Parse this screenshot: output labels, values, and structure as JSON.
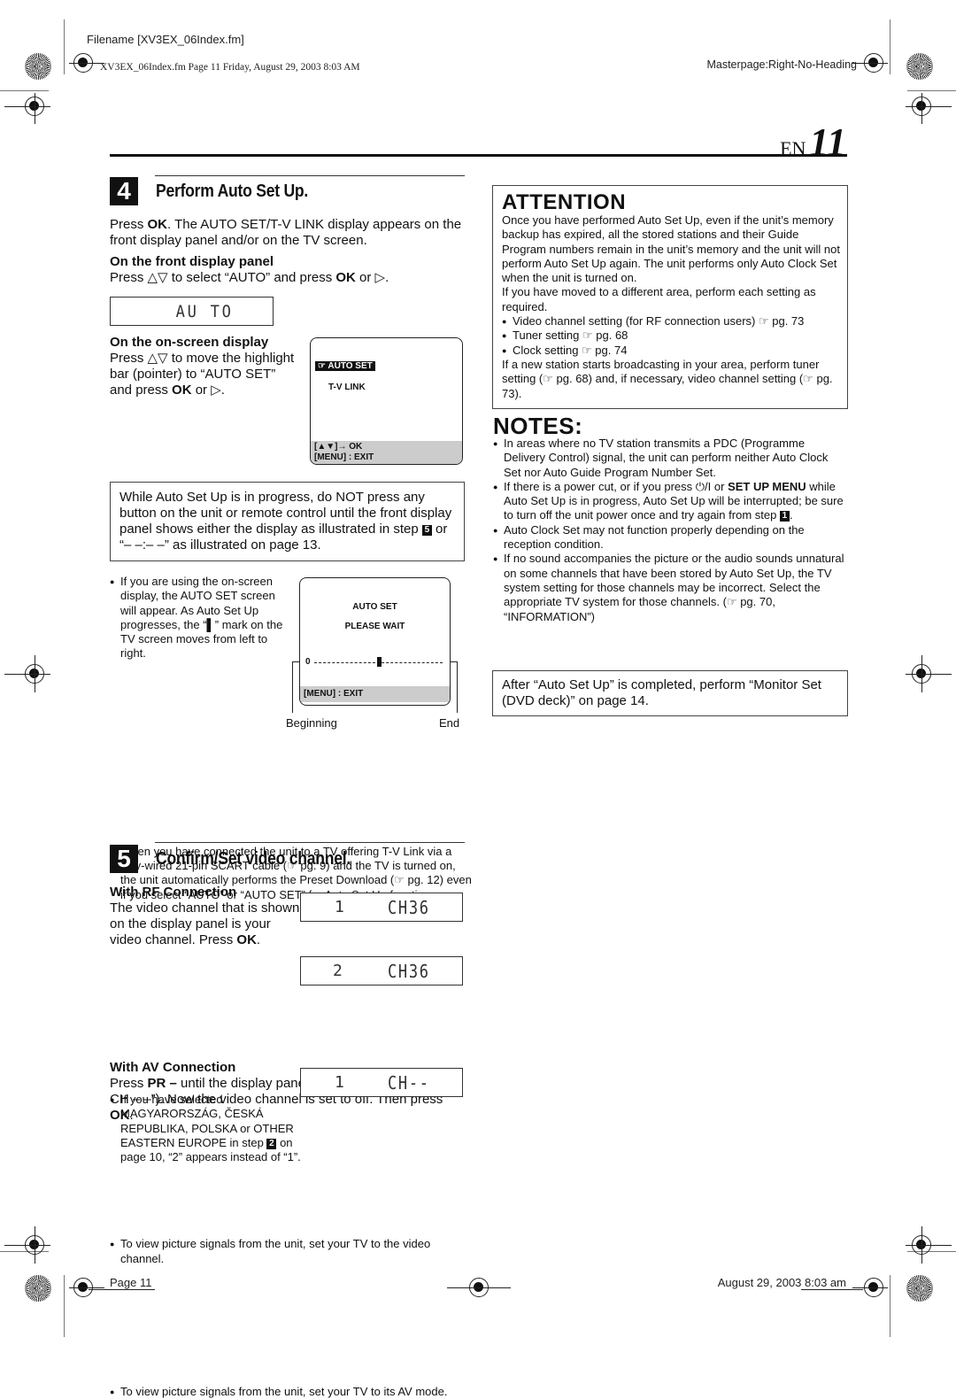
{
  "print_header": {
    "filename": "Filename [XV3EX_06Index.fm]",
    "fileinfo": "XV3EX_06Index.fm  Page 11  Friday, August 29, 2003  8:03 AM",
    "masterpage": "Masterpage:Right-No-Heading"
  },
  "page_marker": {
    "lang": "EN",
    "number": "11"
  },
  "step4": {
    "number": "4",
    "title": "Perform Auto Set Up.",
    "intro_pre": "Press ",
    "intro_ok": "OK",
    "intro_post": ". The AUTO SET/T-V LINK display appears on the front display panel and/or on the TV screen.",
    "front_panel_heading": "On the front display panel",
    "front_panel_pre": "Press △▽ to select “AUTO” and press ",
    "front_panel_ok": "OK",
    "front_panel_post": " or ▷.",
    "lcd_auto": "AU TO",
    "onscreen_heading": "On the on-screen display",
    "onscreen_pre": "Press △▽ to move the highlight bar (pointer) to “AUTO SET” and press ",
    "onscreen_ok": "OK",
    "onscreen_post": " or ▷.",
    "tv_menu": {
      "item_selected": "☞ AUTO SET",
      "item_2": "T-V LINK",
      "footer_1": "[▲▼]→ OK",
      "footer_2": "[MENU] : EXIT"
    },
    "warning_pre": "While Auto Set Up is in progress, do NOT press any button on the unit or remote control until the front display panel shows either the display as illustrated in step ",
    "warning_step": "5",
    "warning_post": " or “– –:– –” as illustrated on page 13.",
    "progress_note": "If you are using the on-screen display, the AUTO SET screen will appear. As Auto Set Up progresses, the “▌” mark on the TV screen moves from left to right.",
    "tv_progress": {
      "title": "AUTO SET",
      "status": "PLEASE WAIT",
      "scale_start": "0",
      "progress_fraction": 0.5,
      "footer": "[MENU] : EXIT",
      "label_beginning": "Beginning",
      "label_end": "End"
    },
    "tvlink_note": "When you have connected the unit to a TV offering T-V Link via a fully-wired 21-pin SCART cable (☞ pg. 9) and the TV is turned on, the unit automatically performs the Preset Download (☞ pg. 12) even if you select “AUTO” or “AUTO SET” for Auto Set Up function."
  },
  "step5": {
    "number": "5",
    "title": "Confirm/Set video channel.",
    "rf_heading": "With RF Connection",
    "rf_pre": "The video channel that is shown on the display panel is your video channel. Press ",
    "rf_ok": "OK",
    "rf_post": ".",
    "lcd_rf1_left": "1",
    "lcd_rf1_right": "CH36",
    "lcd_rf2_left": "2",
    "lcd_rf2_right": "CH36",
    "rf_bullet1_pre": "If you have selected MAGYARORSZÁG, ČESKÁ REPUBLIKA, POLSKA or OTHER EASTERN EUROPE in step ",
    "rf_bullet1_step": "2",
    "rf_bullet1_post": " on page 10, “2” appears instead of “1”.",
    "rf_bullet2": "To view picture signals from the unit, set your TV to the video channel.",
    "av_heading": "With AV Connection",
    "av_pre": "Press ",
    "av_pr": "PR –",
    "av_mid": " until the display panel shows “1 CH – –” (or “2 CH – –”). Now the video channel is set to off. Then press ",
    "av_ok": "OK",
    "av_post": ".",
    "lcd_av_left": "1",
    "lcd_av_right": "CH--",
    "av_bullet": "To view picture signals from the unit, set your TV to its AV mode."
  },
  "attention": {
    "heading": "ATTENTION",
    "para1": "Once you have performed Auto Set Up, even if the unit’s memory backup has expired, all the stored stations and their Guide Program numbers remain in the unit’s memory and the unit will not perform Auto Set Up again. The unit performs only Auto Clock Set when the unit is turned on.",
    "para2": "If you have moved to a different area, perform each setting as required.",
    "bullets": [
      "Video channel setting (for RF connection users) ☞ pg. 73",
      "Tuner setting ☞ pg. 68",
      "Clock setting ☞ pg. 74"
    ],
    "para3": "If a new station starts broadcasting in your area, perform tuner setting (☞ pg. 68) and, if necessary, video channel setting (☞ pg. 73)."
  },
  "notes": {
    "heading": "NOTES:",
    "note1": "In areas where no TV station transmits a PDC (Programme Delivery Control) signal, the unit can perform neither Auto Clock Set nor Auto Guide Program Number Set.",
    "note2_pre": "If there is a power cut, or if you press ⏻/I or ",
    "note2_bold": "SET UP MENU",
    "note2_mid": " while Auto Set Up is in progress, Auto Set Up will be interrupted; be sure to turn off the unit power once and try again from step ",
    "note2_step": "1",
    "note2_post": ".",
    "note3": "Auto Clock Set may not function properly depending on the reception condition.",
    "note4": "If no sound accompanies the picture or the audio sounds unnatural on some channels that have been stored by Auto Set Up, the TV system setting for those channels may be incorrect. Select the appropriate TV system for those channels. (☞ pg. 70, “INFORMATION”)"
  },
  "after_box": "After “Auto Set Up” is completed, perform “Monitor Set (DVD deck)” on page 14.",
  "print_footer": {
    "page": "Page 11",
    "date": "August 29, 2003 8:03 am"
  }
}
